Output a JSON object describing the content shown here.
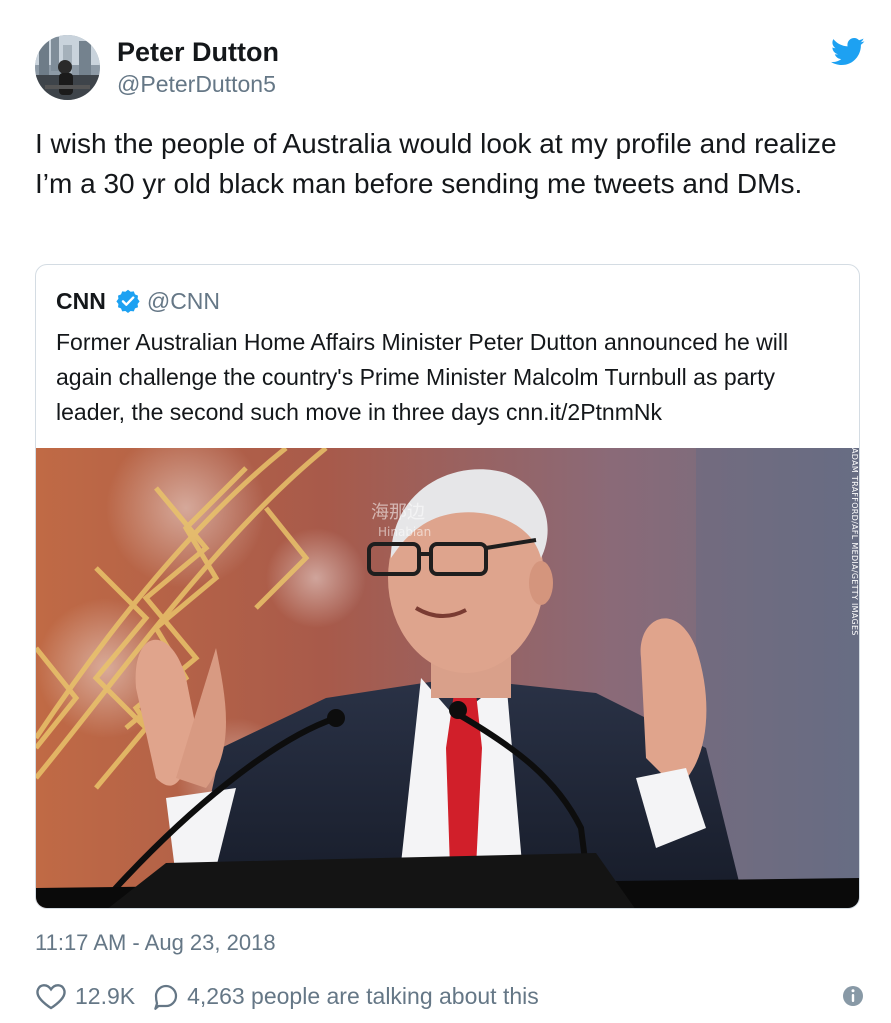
{
  "author": {
    "display_name": "Peter Dutton",
    "handle": "@PeterDutton5"
  },
  "tweet": {
    "text": "I wish the people of Australia would look at my profile and realize I’m a 30 yr old black man before sending me tweets and DMs.",
    "timestamp": "11:17 AM - Aug 23, 2018"
  },
  "quoted": {
    "name": "CNN",
    "handle": "@CNN",
    "text": "Former Australian Home Affairs Minister Peter Dutton announced he will again challenge the country's Prime Minister Malcolm Turnbull as party leader, the second such move in three days cnn.it/2PtnmNk",
    "photo_credit": "ADAM TRAFFORD/AFL MEDIA/GETTY IMAGES",
    "watermark": "海那边 Hinabian"
  },
  "stats": {
    "likes": "12.9K",
    "talking": "4,263 people are talking about this"
  },
  "icons": {
    "brand": "twitter-bird-icon",
    "verified": "verified-badge-icon",
    "like": "heart-icon",
    "reply": "speech-bubble-icon",
    "info": "info-icon"
  },
  "colors": {
    "twitter_blue": "#1da1f2",
    "text": "#14171a",
    "muted": "#657786",
    "border": "#d4dce3",
    "tie_red": "#d11f2a"
  }
}
